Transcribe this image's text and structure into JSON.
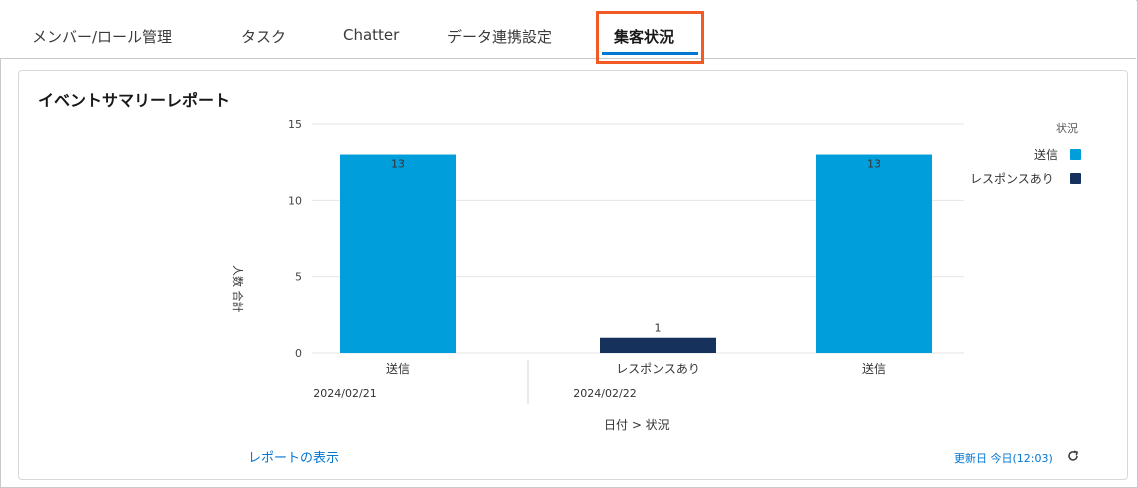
{
  "tabs": [
    {
      "label": "メンバー/ロール管理"
    },
    {
      "label": "タスク"
    },
    {
      "label": "Chatter"
    },
    {
      "label": "データ連携設定"
    },
    {
      "label": "集客状況"
    }
  ],
  "card": {
    "title": "イベントサマリーレポート",
    "report_link": "レポートの表示",
    "updated_text": "更新日 今日(12:03)"
  },
  "colors": {
    "sent": "#009edb",
    "response": "#16325c",
    "highlight": "#f15a24",
    "link": "#0176d3"
  },
  "chart_data": {
    "type": "bar",
    "ylabel": "人数 合計",
    "xlabel": "日付 > 状況",
    "ylim": [
      0,
      15
    ],
    "yticks": [
      0,
      5,
      10,
      15
    ],
    "grid": true,
    "legend_title": "状況",
    "legend_position": "right",
    "series": [
      {
        "name": "送信",
        "color": "#009edb"
      },
      {
        "name": "レスポンスあり",
        "color": "#16325c"
      }
    ],
    "bars": [
      {
        "category": "送信",
        "group": "2024/02/21",
        "series": "送信",
        "value": 13
      },
      {
        "category": "レスポンスあり",
        "group": "2024/02/22",
        "series": "レスポンスあり",
        "value": 1
      },
      {
        "category": "送信",
        "group": "2024/02/22",
        "series": "送信",
        "value": 13
      }
    ],
    "groups": [
      "2024/02/21",
      "2024/02/22"
    ]
  }
}
